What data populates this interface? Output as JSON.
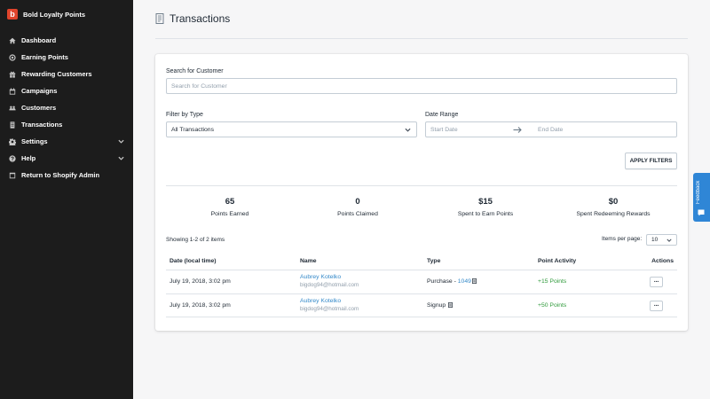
{
  "sidebar": {
    "brand": {
      "logo_letter": "b",
      "name": "Bold Loyalty Points",
      "logo_color": "#e0442c"
    },
    "items": [
      {
        "label": "Dashboard",
        "icon": "home-icon"
      },
      {
        "label": "Earning Points",
        "icon": "target-icon"
      },
      {
        "label": "Rewarding Customers",
        "icon": "gift-icon"
      },
      {
        "label": "Campaigns",
        "icon": "calendar-icon"
      },
      {
        "label": "Customers",
        "icon": "users-icon"
      },
      {
        "label": "Transactions",
        "icon": "receipt-icon",
        "active": true
      },
      {
        "label": "Settings",
        "icon": "gear-icon",
        "expandable": true
      },
      {
        "label": "Help",
        "icon": "help-icon",
        "expandable": true
      },
      {
        "label": "Return to Shopify Admin",
        "icon": "exit-icon"
      }
    ]
  },
  "header": {
    "title": "Transactions",
    "icon": "receipt-icon"
  },
  "filters": {
    "search_label": "Search for Customer",
    "search_placeholder": "Search for Customer",
    "type_label": "Filter by Type",
    "type_value": "All Transactions",
    "date_label": "Date Range",
    "start_placeholder": "Start Date",
    "end_placeholder": "End Date",
    "apply_label": "APPLY FILTERS"
  },
  "stats": [
    {
      "value": "65",
      "label": "Points Earned"
    },
    {
      "value": "0",
      "label": "Points Claimed"
    },
    {
      "value": "$15",
      "label": "Spent to Earn Points"
    },
    {
      "value": "$0",
      "label": "Spent Redeeming Rewards"
    }
  ],
  "table": {
    "showing": "Showing 1-2 of 2 items",
    "items_per_page_label": "Items per page:",
    "items_per_page_value": "10",
    "columns": [
      "Date (local time)",
      "Name",
      "Type",
      "Point Activity",
      "Actions"
    ],
    "rows": [
      {
        "date": "July 19, 2018, 3:02 pm",
        "name": "Aubrey Kotelko",
        "email": "bigdog94@hotmail.com",
        "type": "Purchase - ",
        "type_link": "1049",
        "points": "+15 Points",
        "action": "···"
      },
      {
        "date": "July 19, 2018, 3:02 pm",
        "name": "Aubrey Kotelko",
        "email": "bigdog94@hotmail.com",
        "type": "Signup",
        "type_link": "",
        "points": "+50 Points",
        "action": "···"
      }
    ]
  },
  "feedback": {
    "label": "Feedback",
    "color": "#2f86d6"
  },
  "colors": {
    "sidebar_bg": "#1c1c1c",
    "link": "#3489c9",
    "positive": "#2f9a3b"
  }
}
